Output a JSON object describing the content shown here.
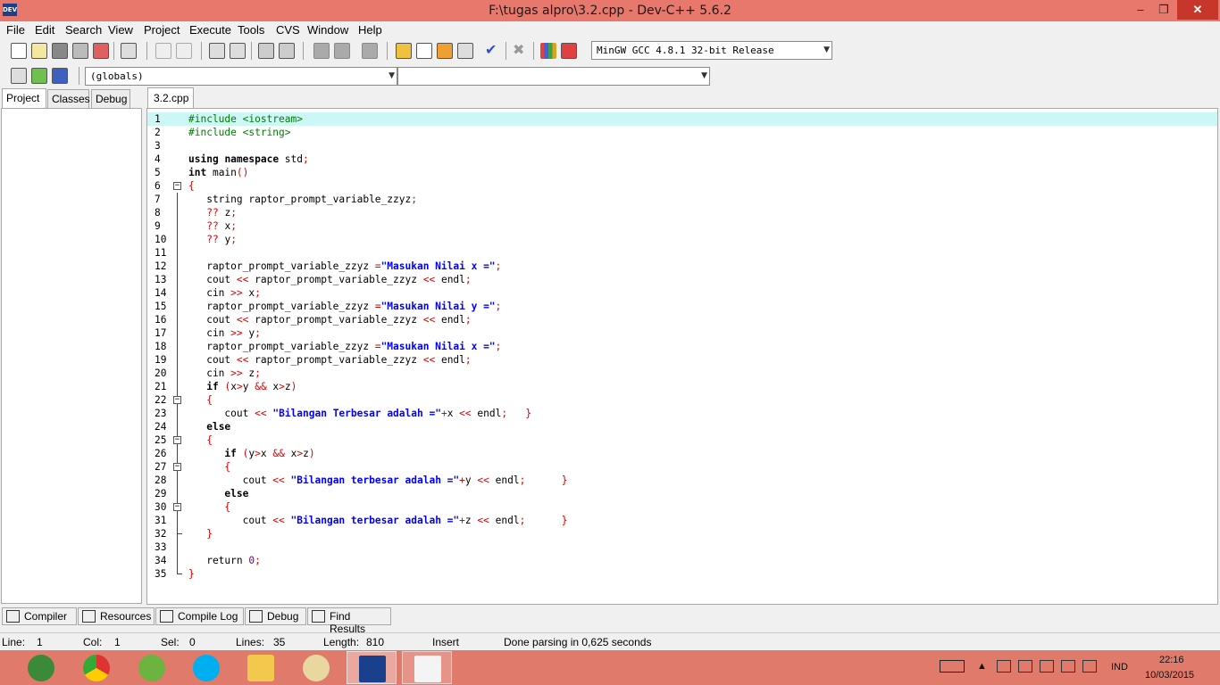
{
  "window": {
    "title": "F:\\tugas alpro\\3.2.cpp - Dev-C++ 5.6.2",
    "app_icon_text": "DEV",
    "minimize": "‒",
    "maximize": "❐",
    "close": "✕"
  },
  "menu": [
    "File",
    "Edit",
    "Search",
    "View",
    "Project",
    "Execute",
    "Tools",
    "CVS",
    "Window",
    "Help"
  ],
  "toolbar": {
    "compiler_select": "MinGW GCC 4.8.1 32-bit Release",
    "globals_select": "(globals)",
    "member_select": ""
  },
  "left_tabs": [
    "Project",
    "Classes",
    "Debug"
  ],
  "editor_tab": "3.2.cpp",
  "code_lines": [
    "#include <iostream>",
    "#include <string>",
    "",
    "using namespace std;",
    "int main()",
    "{",
    "   string raptor_prompt_variable_zzyz;",
    "   ?? z;",
    "   ?? x;",
    "   ?? y;",
    "",
    "   raptor_prompt_variable_zzyz =\"Masukan Nilai x =\";",
    "   cout << raptor_prompt_variable_zzyz << endl;",
    "   cin >> x;",
    "   raptor_prompt_variable_zzyz =\"Masukan Nilai y =\";",
    "   cout << raptor_prompt_variable_zzyz << endl;",
    "   cin >> y;",
    "   raptor_prompt_variable_zzyz =\"Masukan Nilai x =\";",
    "   cout << raptor_prompt_variable_zzyz << endl;",
    "   cin >> z;",
    "   if (x>y && x>z)",
    "   {",
    "      cout << \"Bilangan Terbesar adalah =\"+x << endl;   }",
    "   else",
    "   {",
    "      if (y>x && x>z)",
    "      {",
    "         cout << \"Bilangan terbesar adalah =\"+y << endl;      }",
    "      else",
    "      {",
    "         cout << \"Bilangan terbesar adalah =\"+z << endl;      }",
    "   }",
    "",
    "   return 0;",
    "}"
  ],
  "bottom_tabs": [
    "Compiler",
    "Resources",
    "Compile Log",
    "Debug",
    "Find Results"
  ],
  "status": {
    "line_label": "Line:",
    "line_value": "1",
    "col_label": "Col:",
    "col_value": "1",
    "sel_label": "Sel:",
    "sel_value": "0",
    "lines_label": "Lines:",
    "lines_value": "35",
    "length_label": "Length:",
    "length_value": "810",
    "mode": "Insert",
    "message": "Done parsing in 0,625 seconds"
  },
  "taskbar": {
    "apps": [
      "ie-icon",
      "chrome-icon",
      "utorrent-icon",
      "skype-icon",
      "explorer-icon",
      "paint-icon",
      "devcpp-icon",
      "raptor-icon"
    ],
    "language": "IND",
    "time": "22:16",
    "date": "10/03/2015"
  },
  "colors": {
    "titlebar": "#e8786c",
    "taskbar": "#e07a6a",
    "current_line": "#ccf7f7",
    "keyword_symbol": "#e00000",
    "string": "#0000ff",
    "preprocessor": "#008000",
    "number": "#800080"
  }
}
